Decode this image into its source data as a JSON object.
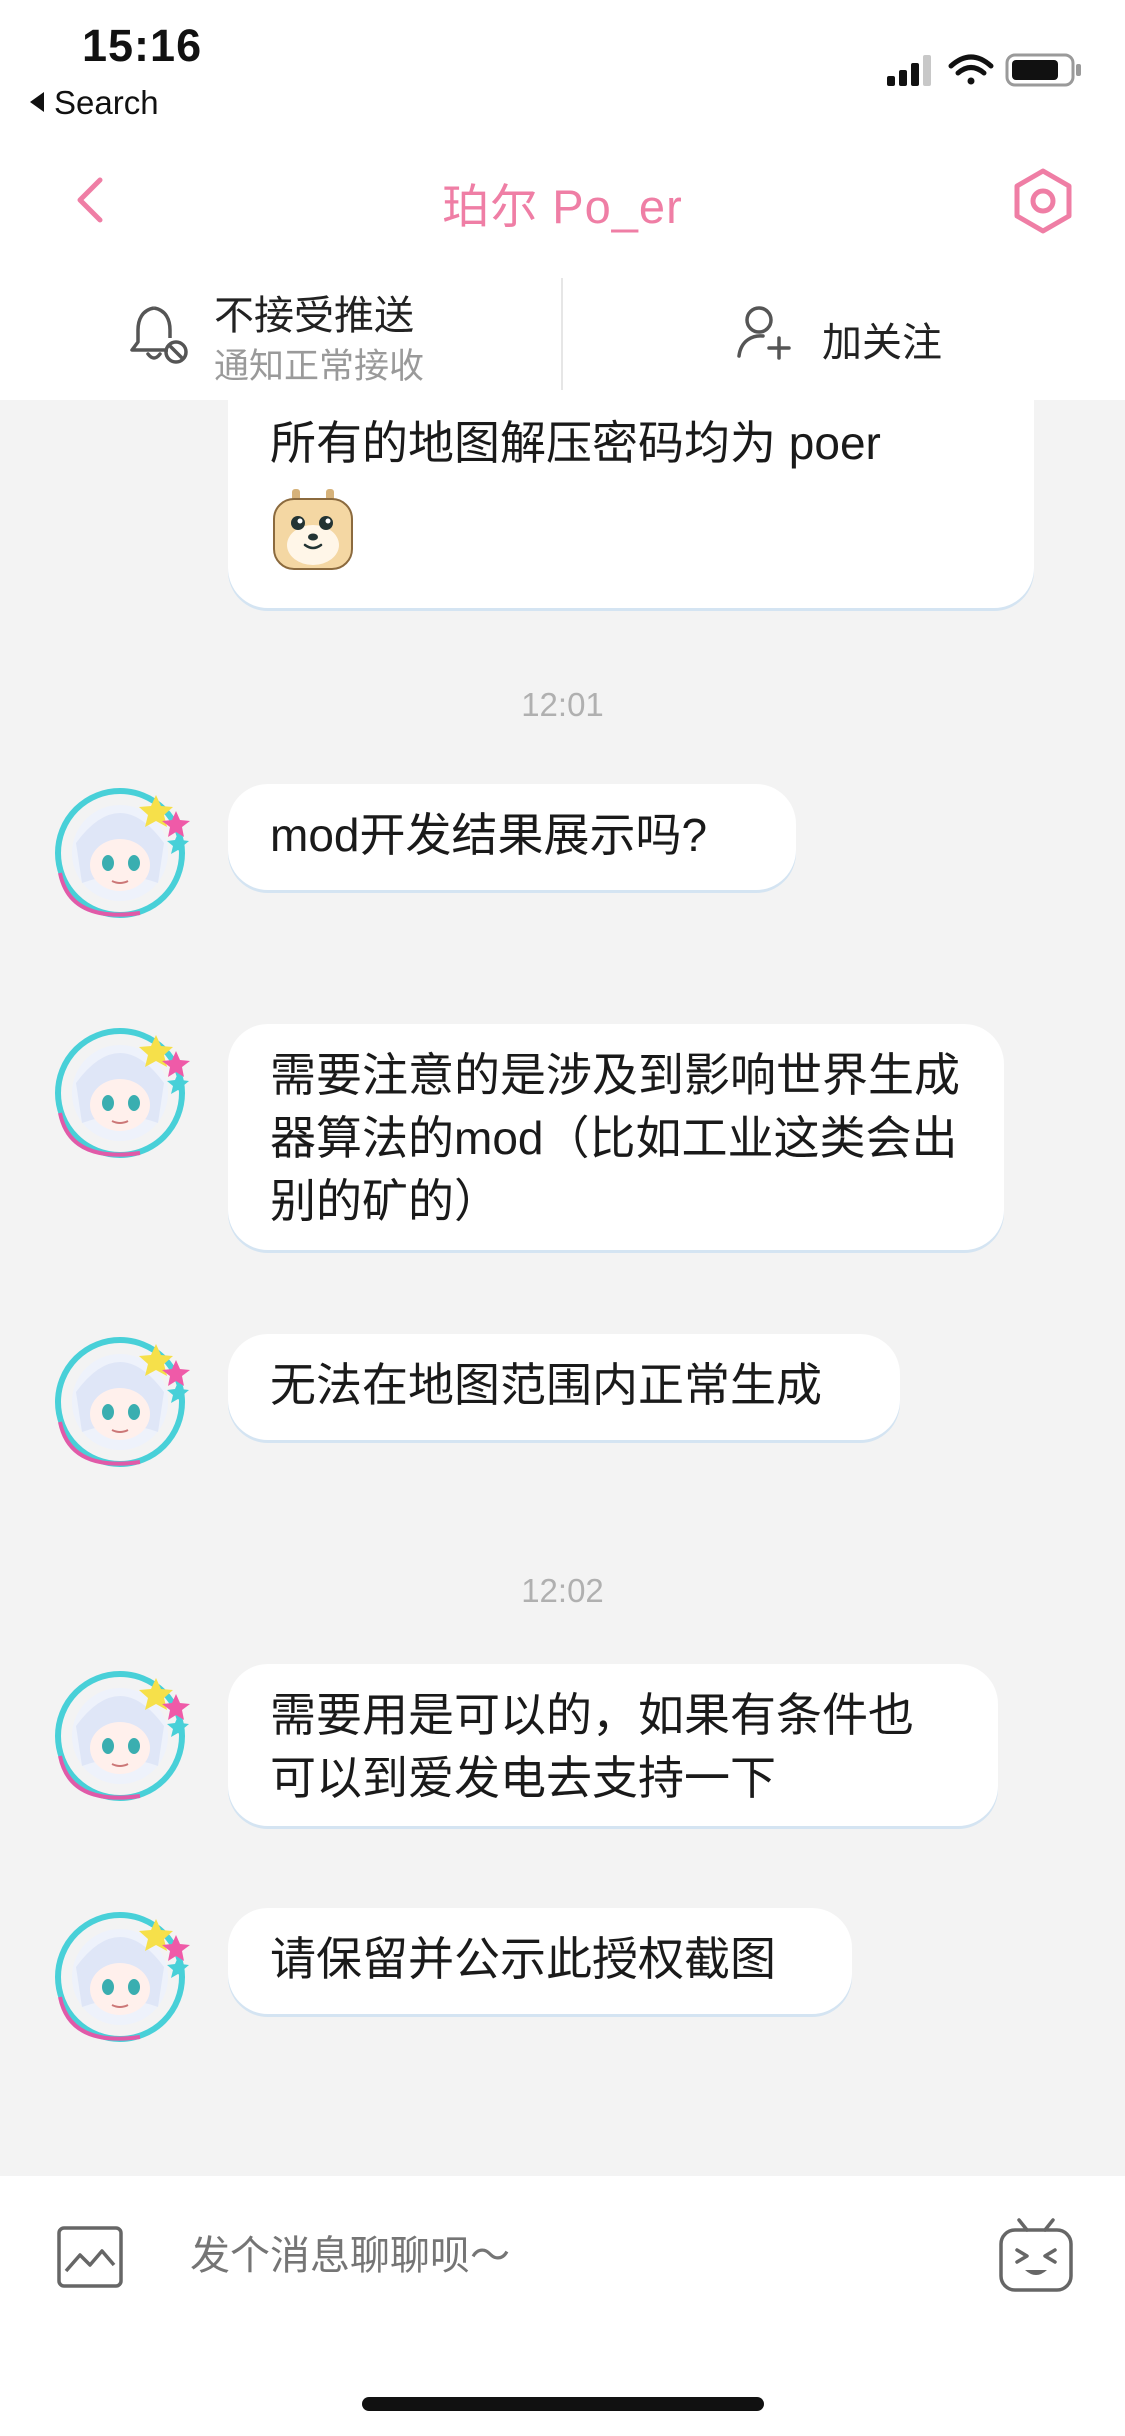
{
  "status_bar": {
    "time": "15:16",
    "back_label": "Search"
  },
  "nav": {
    "title": "珀尔 Po_er",
    "back_icon": "chevron-left-icon",
    "settings_icon": "hexagon-settings-icon",
    "accent_color": "#ef7ea5"
  },
  "info_bar": {
    "push_title": "不接受推送",
    "push_subtitle": "通知正常接收",
    "follow_label": "加关注"
  },
  "messages": [
    {
      "text": "所有的地图解压密码均为 poer",
      "sender": "self",
      "has_sticker": true
    },
    {
      "timestamp": "12:01"
    },
    {
      "text": "mod开发结果展示吗?",
      "sender": "other"
    },
    {
      "text": "需要注意的是涉及到影响世界生成器算法的mod（比如工业这类会出别的矿的）",
      "sender": "other"
    },
    {
      "text": "无法在地图范围内正常生成",
      "sender": "other"
    },
    {
      "timestamp": "12:02"
    },
    {
      "text": "需要用是可以的，如果有条件也可以到爱发电去支持一下",
      "sender": "other"
    },
    {
      "text": "请保留并公示此授权截图",
      "sender": "other"
    }
  ],
  "composer": {
    "placeholder": "发个消息聊聊呗～"
  }
}
